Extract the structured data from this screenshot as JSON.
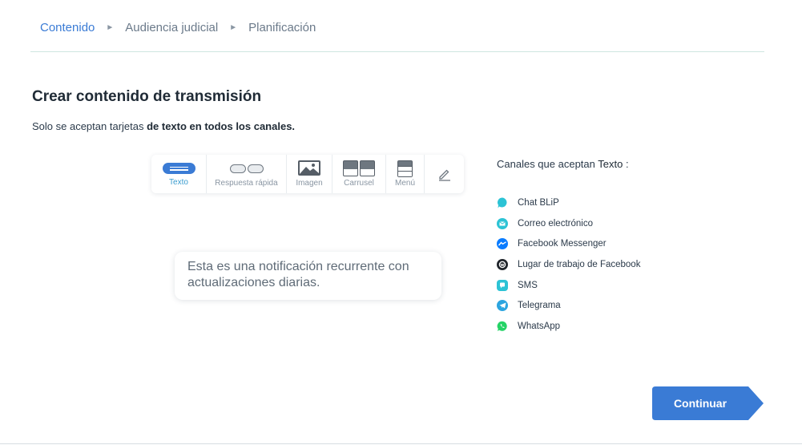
{
  "breadcrumb": {
    "items": [
      "Contenido",
      "Audiencia judicial",
      "Planificación"
    ],
    "separator": "►"
  },
  "page": {
    "title": "Crear contenido de transmisión",
    "subtitle_prefix": "Solo se aceptan tarjetas ",
    "subtitle_bold": "de texto en todos los canales."
  },
  "toolbar": {
    "items": [
      {
        "label": "Texto",
        "icon": "text-card-icon",
        "active": true
      },
      {
        "label": "Respuesta rápida",
        "icon": "quick-reply-icon",
        "active": false
      },
      {
        "label": "Imagen",
        "icon": "image-icon",
        "active": false
      },
      {
        "label": "Carrusel",
        "icon": "carousel-icon",
        "active": false
      },
      {
        "label": "Menú",
        "icon": "menu-icon",
        "active": false
      },
      {
        "label": "",
        "icon": "pencil-icon",
        "active": false
      }
    ]
  },
  "message": {
    "text": "Esta es una notificación recurrente con actualizaciones diarias."
  },
  "channels": {
    "title_prefix": "Canales que aceptan ",
    "title_bold": "Texto",
    "title_suffix": " :",
    "items": [
      {
        "label": "Chat BLiP",
        "icon": "blip-chat-icon",
        "color": "#2cc3d5"
      },
      {
        "label": "Correo electrónico",
        "icon": "email-icon",
        "color": "#2cc3d5"
      },
      {
        "label": "Facebook Messenger",
        "icon": "messenger-icon",
        "color": "#0a7cff"
      },
      {
        "label": "Lugar de trabajo de Facebook",
        "icon": "workplace-icon",
        "color": "#20252b"
      },
      {
        "label": "SMS",
        "icon": "sms-icon",
        "color": "#2cc3d5"
      },
      {
        "label": "Telegrama",
        "icon": "telegram-icon",
        "color": "#2ca5e0"
      },
      {
        "label": "WhatsApp",
        "icon": "whatsapp-icon",
        "color": "#25d366"
      }
    ]
  },
  "actions": {
    "continue_label": "Continuar",
    "continue_color": "#3a7bd5"
  },
  "colors": {
    "accent": "#3a7bd5",
    "active_tab_text": "#3a9ccf",
    "divider": "#cfe6e0"
  }
}
